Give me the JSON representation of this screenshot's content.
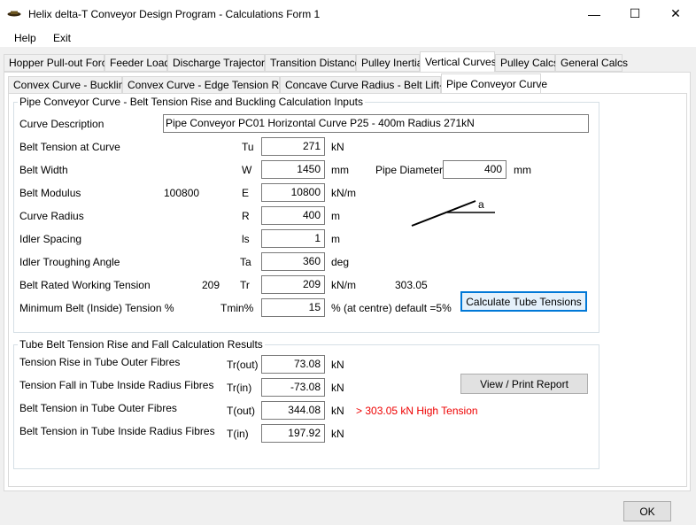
{
  "window": {
    "title": "Helix delta-T Conveyor Design Program - Calculations Form 1"
  },
  "window_controls": {
    "minimize": "—",
    "maximize": "☐",
    "close": "✕"
  },
  "menu": {
    "items": [
      "Help",
      "Exit"
    ]
  },
  "main_tabs": [
    "Hopper Pull-out Force",
    "Feeder Load",
    "Discharge Trajectory",
    "Transition Distance",
    "Pulley Inertia",
    "Vertical Curves",
    "Pulley Calcs",
    "General Calcs"
  ],
  "sub_tabs": [
    "Convex Curve - Buckling",
    "Convex Curve - Edge Tension Rise",
    "Concave Curve Radius - Belt Lift-off",
    "Pipe Conveyor Curve"
  ],
  "inputs_group": {
    "title": "Pipe Conveyor Curve - Belt Tension Rise and Buckling Calculation Inputs",
    "curve_description_label": "Curve Description",
    "curve_description_value": "Pipe Conveyor PC01 Horizontal Curve P25 - 400m Radius 271kN",
    "rows": [
      {
        "label": "Belt Tension at Curve",
        "symbol": "Tu",
        "value": "271",
        "unit": "kN",
        "extra": ""
      },
      {
        "label": "Belt Width",
        "symbol": "W",
        "value": "1450",
        "unit": "mm",
        "extra": ""
      },
      {
        "label": "Belt Modulus",
        "symbol": "E",
        "value": "10800",
        "unit": "kN/m",
        "extra": "100800"
      },
      {
        "label": "Curve Radius",
        "symbol": "R",
        "value": "400",
        "unit": "m",
        "extra": ""
      },
      {
        "label": "Idler Spacing",
        "symbol": "ls",
        "value": "1",
        "unit": "m",
        "extra": ""
      },
      {
        "label": "Idler Troughing Angle",
        "symbol": "Ta",
        "value": "360",
        "unit": "deg",
        "extra": ""
      },
      {
        "label": "Belt Rated Working Tension",
        "symbol": "Tr",
        "value": "209",
        "unit": "kN/m",
        "extra": "209"
      },
      {
        "label": "Minimum Belt (Inside) Tension %",
        "symbol": "Tmin%",
        "value": "15",
        "unit": "% (at centre) default =5%",
        "extra": ""
      }
    ],
    "rated_tension_total": "303.05",
    "pipe_diameter_label": "Pipe Diameter",
    "pipe_diameter_value": "400",
    "pipe_diameter_unit": "mm",
    "angle_label": "a",
    "calculate_button": "Calculate Tube Tensions"
  },
  "results_group": {
    "title": "Tube Belt Tension Rise and Fall Calculation Results",
    "rows": [
      {
        "label": "Tension Rise in Tube Outer Fibres",
        "symbol": "Tr(out)",
        "value": "73.08",
        "unit": "kN"
      },
      {
        "label": "Tension Fall in Tube Inside Radius Fibres",
        "symbol": "Tr(in)",
        "value": "-73.08",
        "unit": "kN"
      },
      {
        "label": "Belt Tension in Tube Outer Fibres",
        "symbol": "T(out)",
        "value": "344.08",
        "unit": "kN"
      },
      {
        "label": "Belt Tension in Tube Inside Radius Fibres",
        "symbol": "T(in)",
        "value": "197.92",
        "unit": "kN"
      }
    ],
    "warning": "> 303.05 kN High Tension",
    "view_print_button": "View / Print Report"
  },
  "ok_button": "OK",
  "colors": {
    "accent": "#0078d7",
    "warning": "#ee0000"
  }
}
